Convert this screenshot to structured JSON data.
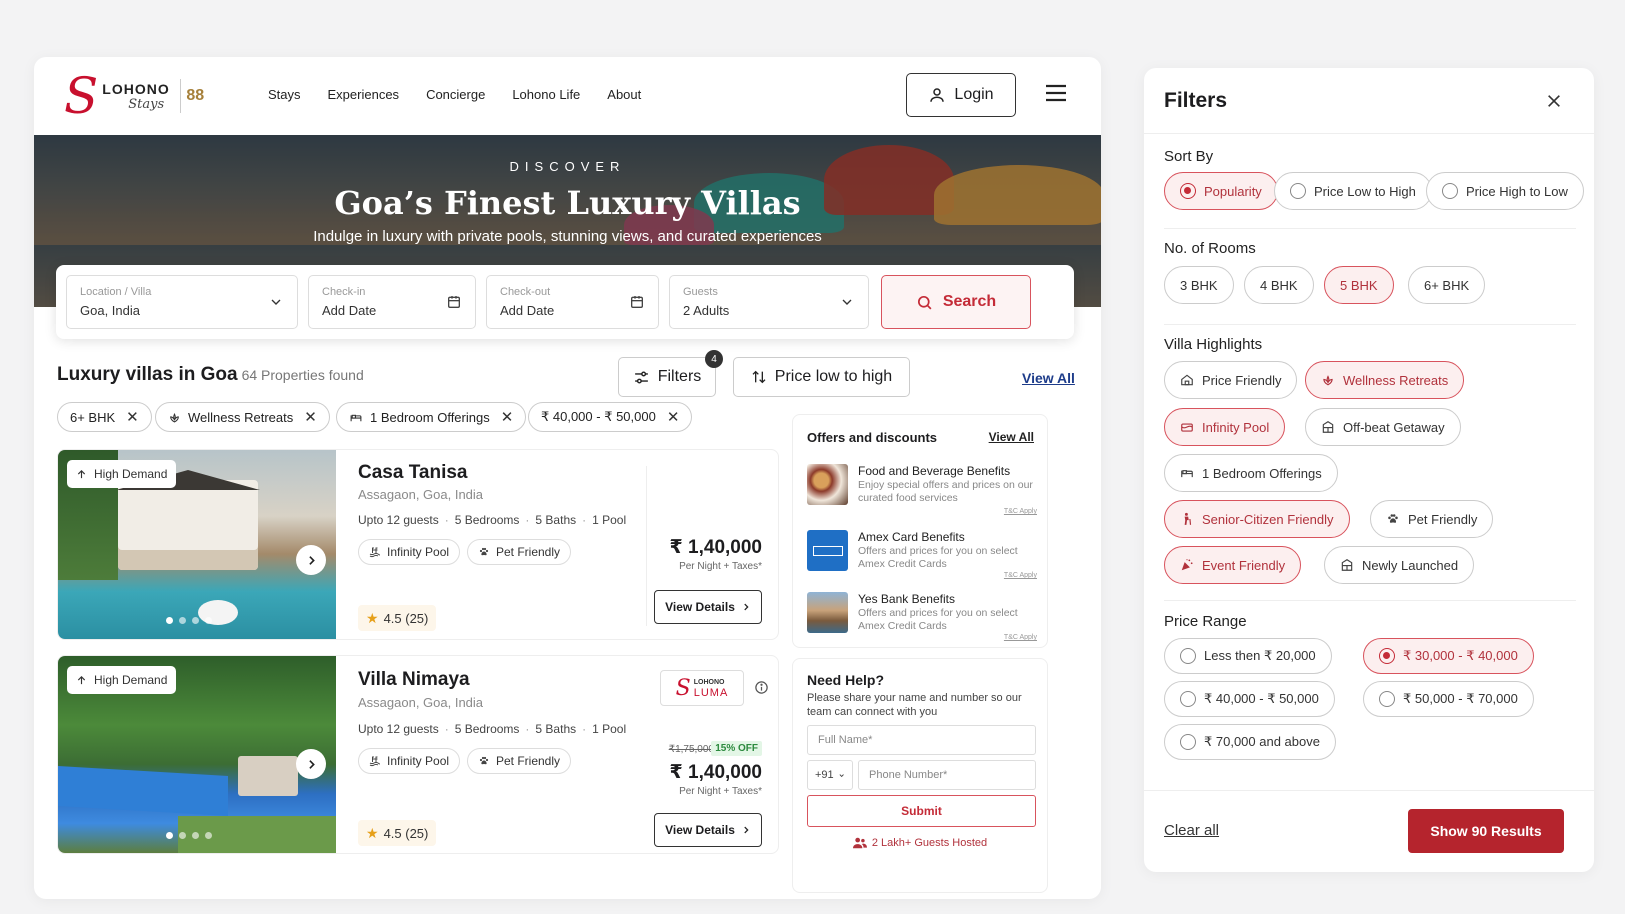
{
  "brand": {
    "name": "LOHONO",
    "sub": "Stays",
    "badge": "88"
  },
  "nav": [
    "Stays",
    "Experiences",
    "Concierge",
    "Lohono Life",
    "About"
  ],
  "header": {
    "login_label": "Login"
  },
  "hero": {
    "kicker": "DISCOVER",
    "title": "Goa’s Finest Luxury Villas",
    "subtitle": "Indulge in luxury with private pools, stunning views, and curated experiences"
  },
  "search": {
    "location": {
      "label": "Location / Villa",
      "value": "Goa, India"
    },
    "checkin": {
      "label": "Check-in",
      "value": "Add Date"
    },
    "checkout": {
      "label": "Check-out",
      "value": "Add Date"
    },
    "guests": {
      "label": "Guests",
      "value": "2 Adults"
    },
    "button": "Search"
  },
  "results": {
    "title": "Luxury villas in Goa",
    "count": "64 Properties found",
    "filters_label": "Filters",
    "filters_count": "4",
    "sort_label": "Price low to high",
    "view_all": "View All"
  },
  "active_chips": [
    {
      "label": "6+ BHK",
      "icon": "none"
    },
    {
      "label": "Wellness Retreats",
      "icon": "lotus-icon"
    },
    {
      "label": "1 Bedroom Offerings",
      "icon": "bed-icon"
    },
    {
      "label": "₹ 40,000 - ₹ 50,000",
      "icon": "none"
    }
  ],
  "listings": [
    {
      "badge": "High Demand",
      "name": "Casa Tanisa",
      "location": "Assagaon, Goa, India",
      "meta": [
        "Upto 12 guests",
        "5 Bedrooms",
        "5 Baths",
        "1 Pool"
      ],
      "amenities": [
        "Infinity Pool",
        "Pet Friendly"
      ],
      "rating": "4.5 (25)",
      "price": "₹ 1,40,000",
      "price_note": "Per Night + Taxes*",
      "cta": "View Details",
      "image_count": 4,
      "active_image": 1
    },
    {
      "badge": "High Demand",
      "name": "Villa Nimaya",
      "location": "Assagaon, Goa, India",
      "meta": [
        "Upto 12 guests",
        "5 Bedrooms",
        "5 Baths",
        "1 Pool"
      ],
      "amenities": [
        "Infinity Pool",
        "Pet Friendly"
      ],
      "rating": "4.5 (25)",
      "old_price": "₹1,75,000",
      "discount": "15% OFF",
      "price": "₹ 1,40,000",
      "price_note": "Per Night + Taxes*",
      "cta": "View Details",
      "partner": {
        "top": "LOHONO",
        "bottom": "LUMA"
      },
      "image_count": 4,
      "active_image": 1
    }
  ],
  "offers": {
    "title": "Offers and discounts",
    "view_all": "View All",
    "items": [
      {
        "title": "Food and Beverage Benefits",
        "desc": "Enjoy special offers and prices on our curated food services",
        "tc": "T&C Apply"
      },
      {
        "title": "Amex Card Benefits",
        "desc": "Offers and prices for you on select Amex Credit Cards",
        "tc": "T&C Apply"
      },
      {
        "title": "Yes Bank Benefits",
        "desc": "Offers and prices for you on select Amex Credit Cards",
        "tc": "T&C Apply"
      }
    ]
  },
  "help": {
    "title": "Need Help?",
    "desc": "Please share your name and number so our team can connect with you",
    "name_placeholder": "Full Name*",
    "country_code": "+91",
    "phone_placeholder": "Phone Number*",
    "submit": "Submit",
    "guests_hosted": "2 Lakh+ Guests Hosted"
  },
  "filters_panel": {
    "title": "Filters",
    "sort_by": {
      "label": "Sort By",
      "options": [
        "Popularity",
        "Price Low to High",
        "Price High to Low"
      ],
      "selected": "Popularity"
    },
    "rooms": {
      "label": "No. of Rooms",
      "options": [
        "3 BHK",
        "4 BHK",
        "5 BHK",
        "6+ BHK"
      ],
      "selected": "5 BHK"
    },
    "highlights": {
      "label": "Villa Highlights",
      "options": [
        "Price Friendly",
        "Wellness Retreats",
        "Infinity Pool",
        "Off-beat Getaway",
        "1 Bedroom Offerings",
        "Senior-Citizen Friendly",
        "Pet Friendly",
        "Event Friendly",
        "Newly Launched"
      ],
      "selected": [
        "Wellness Retreats",
        "Infinity Pool",
        "Senior-Citizen Friendly",
        "Event Friendly"
      ]
    },
    "price_range": {
      "label": "Price Range",
      "options": [
        "Less then ₹ 20,000",
        "₹ 30,000 - ₹ 40,000",
        "₹ 40,000 - ₹ 50,000",
        "₹ 50,000 - ₹ 70,000",
        "₹ 70,000 and above"
      ],
      "selected": "₹ 30,000 - ₹ 40,000"
    },
    "clear_all": "Clear all",
    "show_results": "Show 90 Results"
  },
  "colors": {
    "accent": "#c42b37",
    "accent_bg": "#fcefef",
    "primary_button": "#b5242d",
    "link": "#1d3c8a",
    "discount_green": "#2c8a3e"
  }
}
